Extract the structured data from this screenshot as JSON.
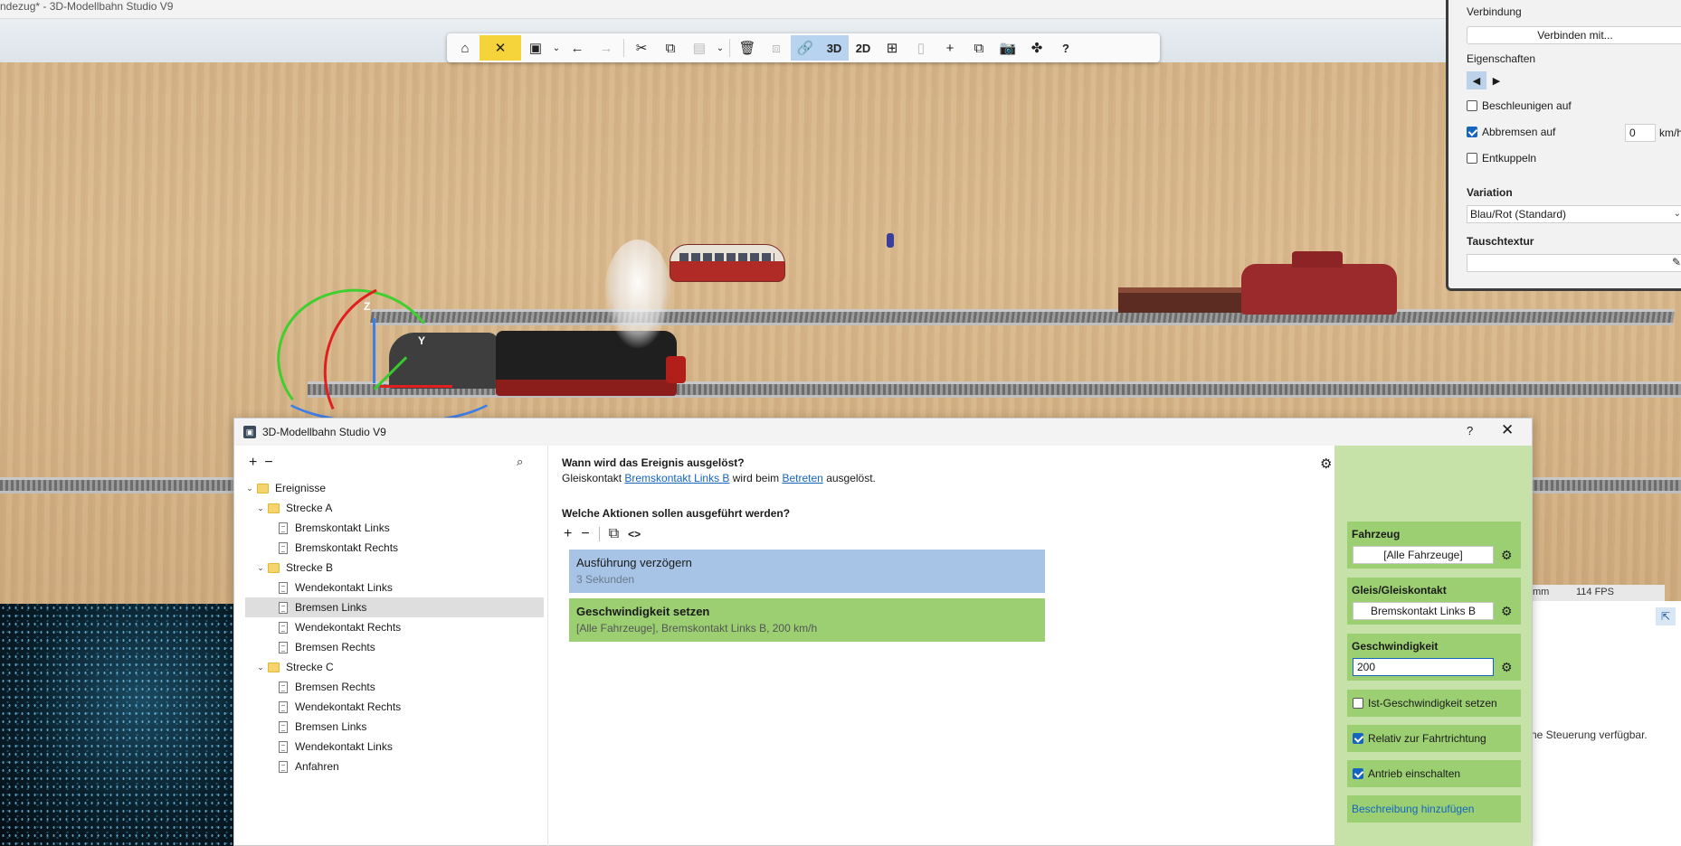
{
  "app_title": "ndezug* - 3D-Modellbahn Studio V9",
  "toolbar": {
    "items": [
      {
        "name": "home-icon",
        "glyph": "⌂"
      },
      {
        "name": "tools-icon",
        "glyph": "✂"
      },
      {
        "name": "save-icon",
        "glyph": "💾"
      },
      {
        "name": "undo-icon",
        "glyph": "←"
      },
      {
        "name": "redo-icon",
        "glyph": "→"
      },
      {
        "name": "cut-icon",
        "glyph": "✂"
      },
      {
        "name": "copy-icon",
        "glyph": "⧉"
      },
      {
        "name": "paste-icon",
        "glyph": "📋"
      },
      {
        "name": "delete-icon",
        "glyph": "🗑"
      }
    ],
    "label_3d": "3D",
    "label_2d": "2D",
    "help": "?"
  },
  "props": {
    "verbindung_label": "Verbindung",
    "connect_button": "Verbinden mit...",
    "eigenschaften_label": "Eigenschaften",
    "beschleunigen_label": "Beschleunigen auf",
    "abbremsen_label": "Abbremsen auf",
    "abbremsen_value": "0",
    "abbremsen_unit": "km/h",
    "entkuppeln_label": "Entkuppeln",
    "variation_label": "Variation",
    "variation_value": "Blau/Rot (Standard)",
    "tauschtextur_label": "Tauschtextur"
  },
  "status": {
    "unit": "mm",
    "fps": "114 FPS"
  },
  "side_message": "ne Steuerung verfügbar.",
  "dialog": {
    "title": "3D-Modellbahn Studio V9",
    "help": "?",
    "close": "✕",
    "tree": {
      "rows": [
        {
          "label": "Ereignisse",
          "type": "folder",
          "level": 0,
          "expanded": true
        },
        {
          "label": "Strecke A",
          "type": "folder",
          "level": 1,
          "expanded": true
        },
        {
          "label": "Bremskontakt Links",
          "type": "doc",
          "level": 2
        },
        {
          "label": "Bremskontakt Rechts",
          "type": "doc",
          "level": 2
        },
        {
          "label": "Strecke B",
          "type": "folder",
          "level": 1,
          "expanded": true
        },
        {
          "label": "Wendekontakt Links",
          "type": "doc",
          "level": 2
        },
        {
          "label": "Bremsen Links",
          "type": "doc",
          "level": 2,
          "selected": true
        },
        {
          "label": "Wendekontakt Rechts",
          "type": "doc",
          "level": 2
        },
        {
          "label": "Bremsen Rechts",
          "type": "doc",
          "level": 2
        },
        {
          "label": "Strecke C",
          "type": "folder",
          "level": 1,
          "expanded": true
        },
        {
          "label": "Bremsen Rechts",
          "type": "doc",
          "level": 2
        },
        {
          "label": "Wendekontakt Rechts",
          "type": "doc",
          "level": 2
        },
        {
          "label": "Bremsen Links",
          "type": "doc",
          "level": 2
        },
        {
          "label": "Wendekontakt Links",
          "type": "doc",
          "level": 2
        },
        {
          "label": "Anfahren",
          "type": "doc",
          "level": 2
        }
      ]
    },
    "trigger_question": "Wann wird das Ereignis ausgelöst?",
    "trigger": {
      "prefix": "Gleiskontakt",
      "contact": "Bremskontakt Links B",
      "middle": "wird beim",
      "mode": "Betreten",
      "suffix": "ausgelöst."
    },
    "actions_question": "Welche Aktionen sollen ausgeführt werden?",
    "actions": [
      {
        "title": "Ausführung verzögern",
        "subtitle": "3 Sekunden"
      },
      {
        "title": "Geschwindigkeit setzen",
        "subtitle": "[Alle Fahrzeuge], Bremskontakt Links B, 200 km/h"
      }
    ],
    "green_panel": {
      "fahrzeug_label": "Fahrzeug",
      "fahrzeug_value": "[Alle Fahrzeuge]",
      "gleis_label": "Gleis/Gleiskontakt",
      "gleis_value": "Bremskontakt Links B",
      "speed_label": "Geschwindigkeit",
      "speed_value": "200",
      "ist_label": "Ist-Geschwindigkeit setzen",
      "relativ_label": "Relativ zur Fahrtrichtung",
      "antrieb_label": "Antrieb einschalten",
      "beschreibung_link": "Beschreibung hinzufügen"
    }
  }
}
